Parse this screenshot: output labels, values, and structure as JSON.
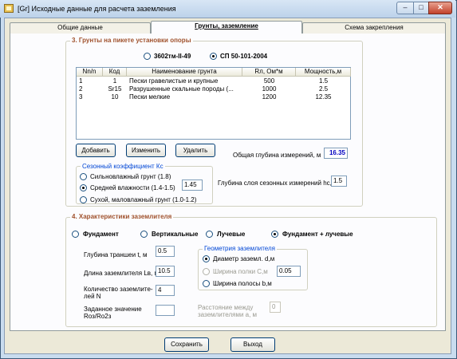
{
  "window": {
    "title": "[Gr] Исходные данные для расчета заземления",
    "min_glyph": "–",
    "max_glyph": "□",
    "close_glyph": "✕"
  },
  "tabs": [
    {
      "label": "Общие данные",
      "active": false
    },
    {
      "label": "Грунты, заземление",
      "active": true
    },
    {
      "label": "Схема закрепления",
      "active": false
    }
  ],
  "soils": {
    "legend": "3. Грунты на пикете установки опоры",
    "standards": [
      {
        "label": "3602тм-II-49",
        "selected": false
      },
      {
        "label": "СП 50-101-2004",
        "selected": true
      }
    ],
    "columns": [
      "Nn/n",
      "Код",
      "Наименование грунта",
      "Rл, Ом*м",
      "Мощность,м"
    ],
    "rows": [
      [
        "1",
        "1",
        "Пески гравелистые и крупные",
        "500",
        "1.5"
      ],
      [
        "2",
        "Sr15",
        "Разрушенные скальные породы (...",
        "1000",
        "2.5"
      ],
      [
        "3",
        "10",
        "Пески мелкие",
        "1200",
        "12.35"
      ]
    ],
    "add_label": "Добавить",
    "edit_label": "Изменить",
    "delete_label": "Удалить",
    "total_depth_label": "Общая глубина измерений, м",
    "total_depth_value": "16.35",
    "seasonal": {
      "legend": "Сезонный коэффициент Кс",
      "options": [
        {
          "label": "Сильновлажный грунт (1.8)",
          "selected": false
        },
        {
          "label": "Средней влажности (1.4-1.5)",
          "selected": true
        },
        {
          "label": "Сухой, маловлажный грунт (1.0-1.2)",
          "selected": false
        }
      ],
      "value": "1.45"
    },
    "seasonal_depth_label": "Глубина слоя сезонных измерений hc, м",
    "seasonal_depth_value": "1.5"
  },
  "grounding": {
    "legend": "4. Характеристики заземлителя",
    "types": [
      {
        "label": "Фундамент",
        "selected": false
      },
      {
        "label": "Вертикальные",
        "selected": false
      },
      {
        "label": "Лучевые",
        "selected": false
      },
      {
        "label": "Фундамент + лучевые",
        "selected": true
      }
    ],
    "trench_depth_label": "Глубина траншеи t, м",
    "trench_depth_value": "0.5",
    "length_label": "Длина заземлителя Lв, м",
    "length_value": "10.5",
    "count_label_1": "Количество заземлите-",
    "count_label_2": "лей N",
    "count_value": "4",
    "ratio_label_1": "Заданное значение",
    "ratio_label_2": "Rоз/Rо2з",
    "ratio_value": "",
    "geometry": {
      "legend": "Геометрия заземлителя",
      "options": [
        {
          "label": "Диаметр заземл. d,м",
          "selected": true,
          "enabled": true
        },
        {
          "label": "Ширина полки С,м",
          "selected": false,
          "enabled": false
        },
        {
          "label": "Ширина полосы b,м",
          "selected": false,
          "enabled": true
        }
      ],
      "value": "0.05"
    },
    "distance_label_1": "Расстояние между",
    "distance_label_2": "заземлителями а, м",
    "distance_value": "0"
  },
  "footer": {
    "save_label": "Сохранить",
    "exit_label": "Выход"
  }
}
